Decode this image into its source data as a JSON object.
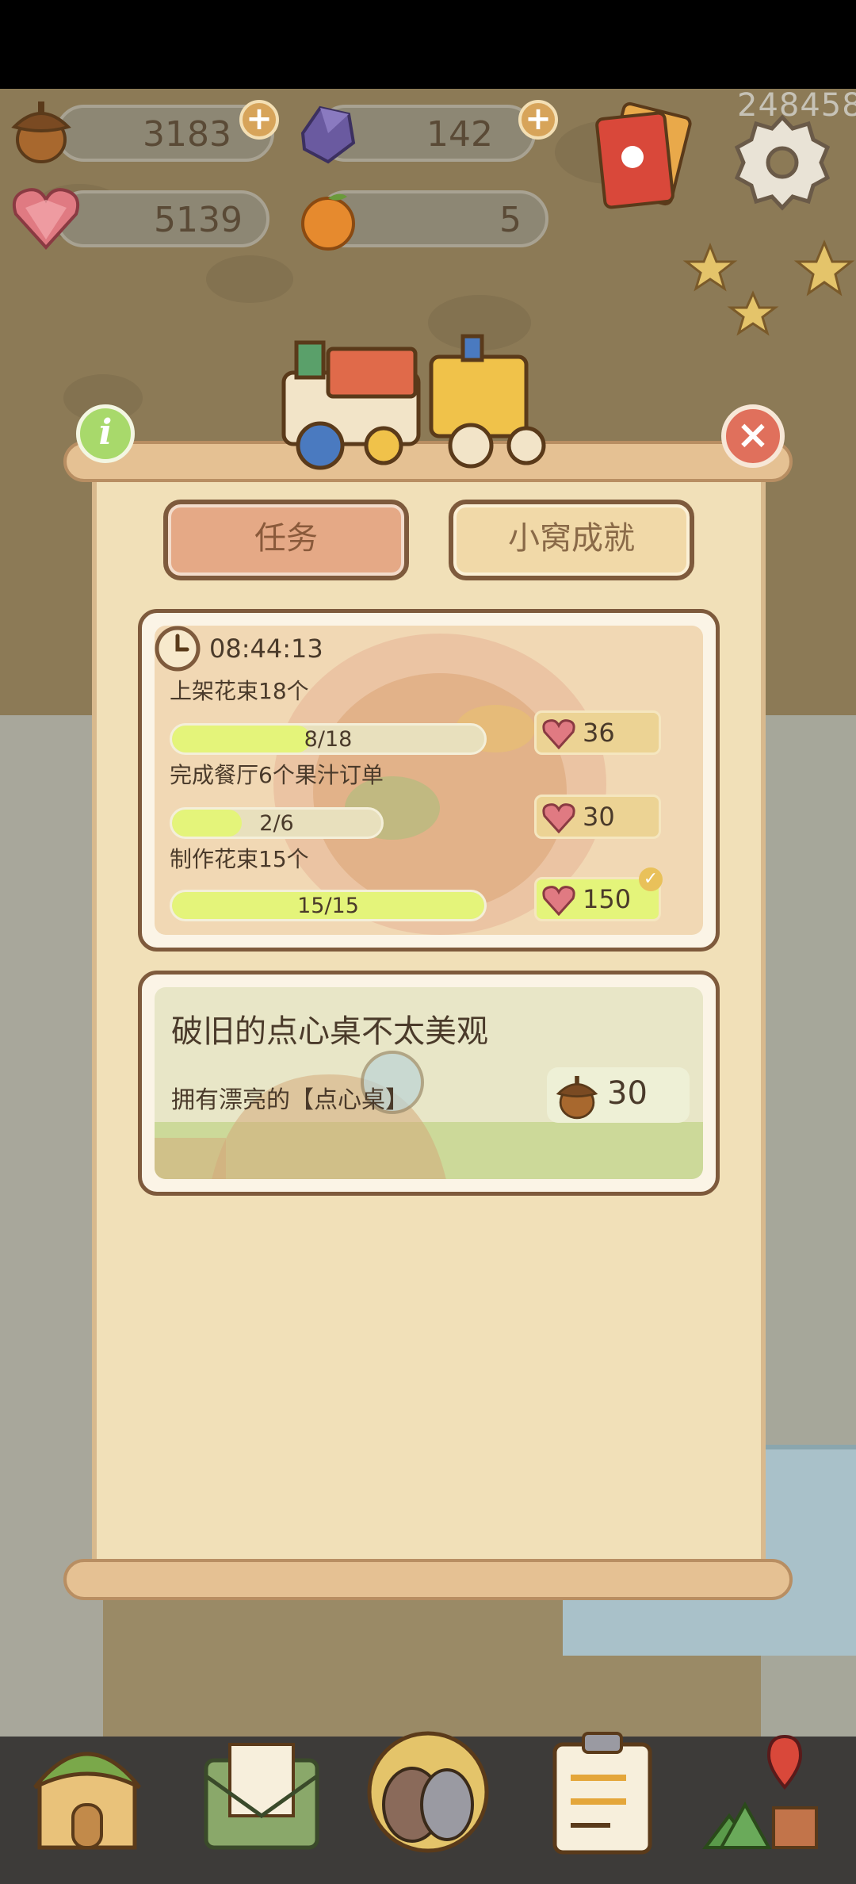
{
  "resources": {
    "acorns": "3183",
    "gems": "142",
    "hearts": "5139",
    "oranges": "5"
  },
  "player_id": "248458",
  "tabs": [
    {
      "label": "任务",
      "active": true
    },
    {
      "label": "小窝成就",
      "active": false
    }
  ],
  "daily_tasks": {
    "timer": "08:44:13",
    "items": [
      {
        "title": "上架花束18个",
        "progress_text": "8/18",
        "progress": 0.444,
        "reward": "36",
        "completed": false
      },
      {
        "title": "完成餐厅6个果汁订单",
        "progress_text": "2/6",
        "progress": 0.333,
        "reward": "30",
        "completed": false
      },
      {
        "title": "制作花束15个",
        "progress_text": "15/15",
        "progress": 1.0,
        "reward": "150",
        "completed": true
      }
    ]
  },
  "achievement": {
    "title": "破旧的点心桌不太美观",
    "description": "拥有漂亮的【点心桌】",
    "reward": "30"
  },
  "colors": {
    "board": "#f1e0b8",
    "progress_fill": "#e4f47a",
    "tab_active": "#e5a986",
    "tab_inactive": "#f1d9a8",
    "close": "#e0705c",
    "info": "#a8d96b"
  },
  "icons": {
    "acorn": "acorn-icon",
    "gem": "gem-icon",
    "heart": "heart-gem-icon",
    "orange": "orange-icon",
    "settings": "gear-icon",
    "timer": "clock-icon"
  }
}
